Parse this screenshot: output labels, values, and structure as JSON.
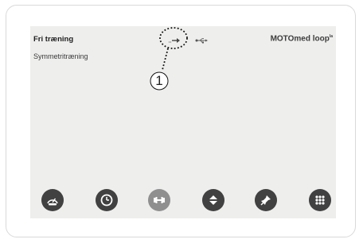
{
  "header": {
    "title": "Fri træning",
    "subtitle": "Symmetritræning",
    "brand": "MOTOmed loop",
    "brand_sup": "la"
  },
  "callout": {
    "label": "1"
  },
  "status_icons": [
    "direction-arrow-icon",
    "usb-icon"
  ],
  "toolbar": [
    {
      "icon": "speedometer-icon",
      "state": "active"
    },
    {
      "icon": "clock-icon",
      "state": "active"
    },
    {
      "icon": "dumbbell-icon",
      "state": "disabled"
    },
    {
      "icon": "up-down-arrows-icon",
      "state": "active"
    },
    {
      "icon": "pin-icon",
      "state": "active"
    },
    {
      "icon": "grid-menu-icon",
      "state": "active"
    }
  ],
  "colors": {
    "screen_bg": "#eeeeed",
    "button_active": "#414141",
    "button_disabled": "#8f8f8f"
  }
}
